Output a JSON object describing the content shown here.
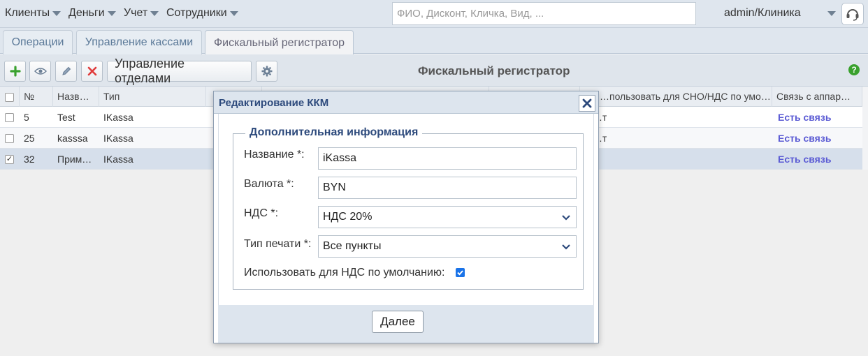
{
  "menu": {
    "items": [
      {
        "label": "Клиенты"
      },
      {
        "label": "Деньги"
      },
      {
        "label": "Учет"
      },
      {
        "label": "Сотрудники"
      }
    ],
    "search_placeholder": "ФИО, Дисконт, Кличка, Вид, ...",
    "user": "admin/Клиника"
  },
  "tabs": [
    {
      "label": "Операции",
      "active": false
    },
    {
      "label": "Управление кассами",
      "active": false
    },
    {
      "label": "Фискальный регистратор",
      "active": true
    }
  ],
  "toolbar": {
    "departments_label": "Управление отделами",
    "title": "Фискальный регистратор",
    "help": "?"
  },
  "grid": {
    "headers": [
      "№",
      "Назв…",
      "Тип",
      "",
      "",
      "",
      "…пользовать для СНО/НДС по умо…",
      "Связь с аппар…"
    ],
    "rows": [
      {
        "checked": false,
        "num": "5",
        "name": "Test",
        "type": "IKassa",
        "vat_default": "…т",
        "connection": "Есть связь"
      },
      {
        "checked": false,
        "num": "25",
        "name": "kasssa",
        "type": "IKassa",
        "vat_default": "…т",
        "connection": "Есть связь"
      },
      {
        "checked": true,
        "num": "32",
        "name": "Прим…",
        "type": "IKassa",
        "vat_default": "",
        "connection": "Есть связь"
      }
    ]
  },
  "modal": {
    "title": "Редактирование ККМ",
    "legend": "Дополнительная информация",
    "fields": {
      "name_label": "Название *:",
      "name_value": "iKassa",
      "currency_label": "Валюта *:",
      "currency_value": "BYN",
      "vat_label": "НДС *:",
      "vat_value": "НДС 20%",
      "print_type_label": "Тип печати *:",
      "print_type_value": "Все пункты",
      "default_vat_label": "Использовать для НДС по умолчанию:",
      "default_vat_checked": true
    },
    "next_label": "Далее"
  },
  "colors": {
    "accent": "#2d4a7c",
    "link": "#5b5bd4",
    "checkbox": "#1a73e8",
    "add": "#3aa12e",
    "delete": "#e03b3b"
  }
}
